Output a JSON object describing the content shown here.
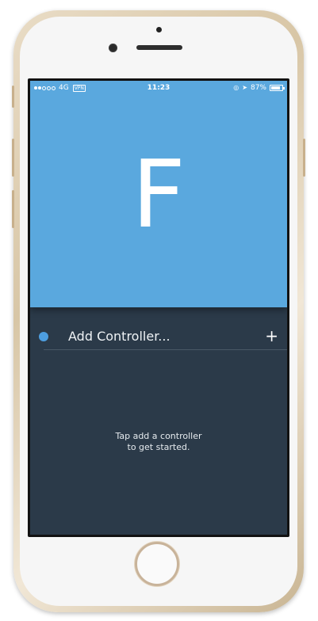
{
  "status_bar": {
    "network": "4G",
    "vpn": "VPN",
    "time": "11:23",
    "battery": "87%",
    "battery_level": 0.87,
    "signal_dots_full": 2,
    "signal_dots_total": 5
  },
  "hero": {
    "logo_letter": "F",
    "background_color": "#5aa8de"
  },
  "list": {
    "add_controller_label": "Add Controller...",
    "add_icon_glyph": "+",
    "dot_color": "#4d9ee0",
    "empty_line_1": "Tap add a controller",
    "empty_line_2": "to get started."
  }
}
